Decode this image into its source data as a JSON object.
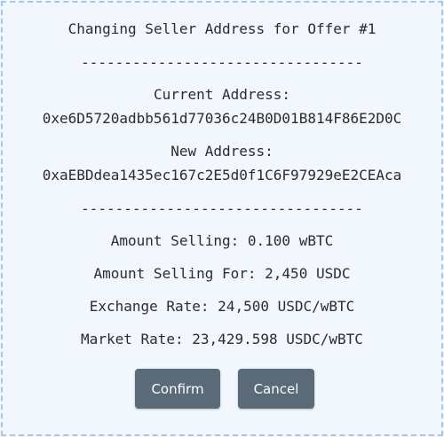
{
  "dialog": {
    "title": "Changing Seller Address for Offer #1",
    "separator": "---------------------------------",
    "current_address_label": "Current Address:",
    "current_address": "0xe6D5720adbb561d77036c24B0D01B814F86E2D0C",
    "new_address_label": "New Address:",
    "new_address": "0xaEBDdea1435ec167c2E5d0f1C6F97929eE2CEAca",
    "amount_selling": "Amount Selling: 0.100 wBTC",
    "amount_selling_for": "Amount Selling For: 2,450 USDC",
    "exchange_rate": "Exchange Rate: 24,500 USDC/wBTC",
    "market_rate": "Market Rate: 23,429.598 USDC/wBTC"
  },
  "buttons": {
    "confirm_label": "Confirm",
    "cancel_label": "Cancel"
  },
  "colors": {
    "background": "#f1f7fd",
    "border": "#a9c6e4",
    "button": "#5a6a78",
    "text": "#2c2c2c"
  }
}
